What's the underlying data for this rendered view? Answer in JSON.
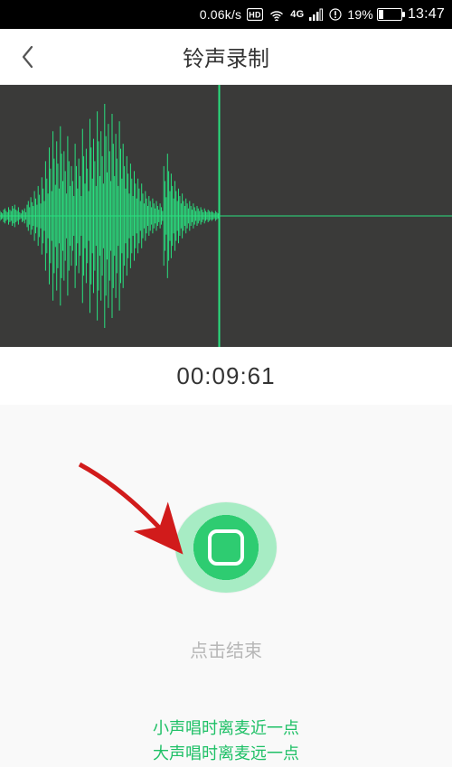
{
  "status_bar": {
    "net_speed": "0.06k/s",
    "battery_percent_text": "19%",
    "battery_percent": 19,
    "clock": "13:47"
  },
  "app_bar": {
    "title": "铃声录制"
  },
  "timer": "00:09:61",
  "record": {
    "hint": "点击结束"
  },
  "tips": {
    "line1": "小声唱时离麦近一点",
    "line2": "大声唱时离麦远一点"
  },
  "colors": {
    "waveform": "#29e07f",
    "accent": "#2ecc71",
    "tip_text": "#1ec066",
    "arrow": "#d11b1b"
  },
  "waveform": {
    "samples": [
      4,
      3,
      2,
      5,
      6,
      4,
      3,
      7,
      5,
      4,
      8,
      6,
      9,
      5,
      4,
      7,
      3,
      2,
      5,
      4,
      6,
      3,
      9,
      12,
      7,
      15,
      11,
      8,
      20,
      14,
      9,
      24,
      17,
      10,
      31,
      22,
      12,
      44,
      30,
      18,
      55,
      38,
      20,
      68,
      46,
      25,
      60,
      42,
      22,
      72,
      50,
      28,
      52,
      36,
      18,
      64,
      44,
      24,
      40,
      28,
      16,
      58,
      40,
      22,
      46,
      32,
      16,
      70,
      48,
      26,
      54,
      38,
      20,
      78,
      55,
      30,
      62,
      44,
      24,
      84,
      60,
      32,
      68,
      48,
      26,
      90,
      64,
      35,
      74,
      52,
      28,
      82,
      58,
      32,
      66,
      46,
      24,
      76,
      54,
      30,
      58,
      40,
      22,
      48,
      34,
      18,
      42,
      30,
      16,
      36,
      26,
      14,
      30,
      22,
      12,
      26,
      18,
      10,
      20,
      14,
      8,
      16,
      12,
      7,
      14,
      10,
      6,
      12,
      8,
      5,
      10,
      7,
      4,
      40,
      28,
      15,
      50,
      36,
      20,
      34,
      24,
      14,
      28,
      20,
      12,
      22,
      16,
      10,
      18,
      12,
      8,
      14,
      10,
      6,
      12,
      8,
      5,
      10,
      7,
      4,
      8,
      6,
      4,
      7,
      5,
      3,
      6,
      4,
      3,
      5,
      4,
      3,
      4,
      3,
      2,
      4,
      3,
      2
    ],
    "playhead_fraction": 0.485
  }
}
